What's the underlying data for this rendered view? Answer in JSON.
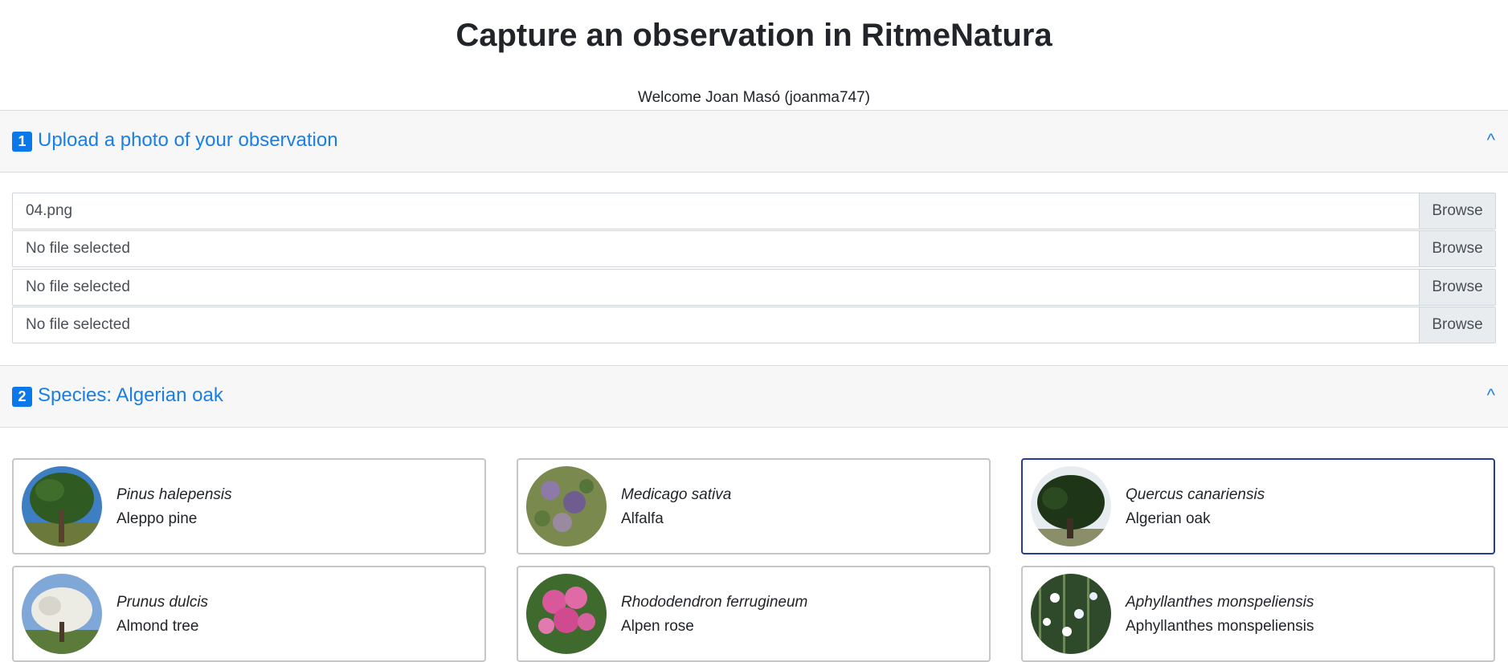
{
  "page": {
    "title": "Capture an observation in RitmeNatura",
    "welcome": "Welcome Joan Masó (joanma747)"
  },
  "upload_section": {
    "number": "1",
    "title": "Upload a photo of your observation",
    "collapse_icon": "^",
    "files": [
      {
        "name": "04.png",
        "button": "Browse"
      },
      {
        "name": "No file selected",
        "button": "Browse"
      },
      {
        "name": "No file selected",
        "button": "Browse"
      },
      {
        "name": "No file selected",
        "button": "Browse"
      }
    ]
  },
  "species_section": {
    "number": "2",
    "title": "Species: Algerian oak",
    "collapse_icon": "^",
    "species": [
      {
        "scientific": "Pinus halepensis",
        "common": "Aleppo pine",
        "icon": "pine-tree-photo",
        "selected": false
      },
      {
        "scientific": "Medicago sativa",
        "common": "Alfalfa",
        "icon": "alfalfa-photo",
        "selected": false
      },
      {
        "scientific": "Quercus canariensis",
        "common": "Algerian oak",
        "icon": "oak-tree-photo",
        "selected": true
      },
      {
        "scientific": "Prunus dulcis",
        "common": "Almond tree",
        "icon": "almond-tree-photo",
        "selected": false
      },
      {
        "scientific": "Rhododendron ferrugineum",
        "common": "Alpen rose",
        "icon": "alpen-rose-photo",
        "selected": false
      },
      {
        "scientific": "Aphyllanthes monspeliensis",
        "common": "Aphyllanthes monspeliensis",
        "icon": "aphyllanthes-photo",
        "selected": false
      }
    ]
  },
  "colors": {
    "accent": "#1a7fe4",
    "badge": "#0b78ea",
    "selected_border": "#253c94"
  }
}
